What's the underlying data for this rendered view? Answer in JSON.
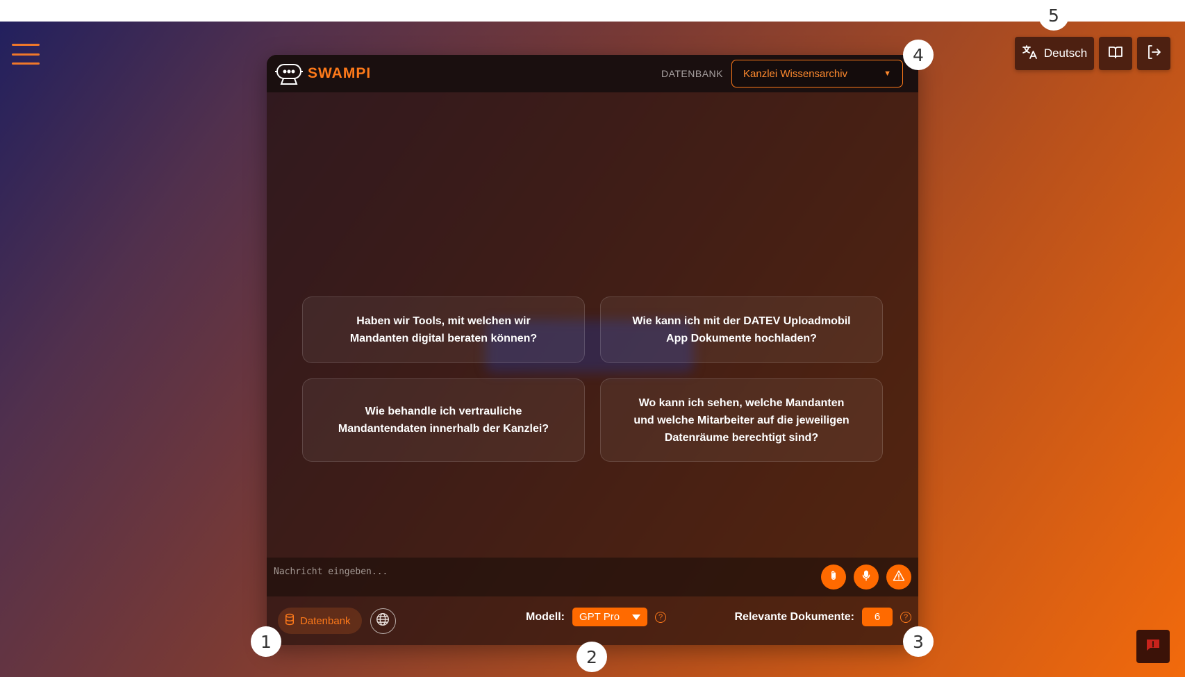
{
  "header": {
    "brand": "SWAMPI",
    "db_label": "DATENBANK",
    "db_selected": "Kanzlei Wissensarchiv"
  },
  "top_right": {
    "language": "Deutsch",
    "icons": [
      "translate-icon",
      "book-open-icon",
      "logout-icon"
    ]
  },
  "suggestions": [
    "Haben wir Tools, mit welchen wir Mandanten digital beraten können?",
    "Wie kann ich mit der DATEV Uploadmobil App Dokumente hochladen?",
    "Wie behandle ich vertrauliche Mandantendaten innerhalb der Kanzlei?",
    "Wo kann ich sehen, welche Mandanten und welche Mitarbeiter auf die jeweiligen Datenräume berechtigt sind?"
  ],
  "input": {
    "placeholder": "Nachricht eingeben...",
    "actions": [
      "paperclip-icon",
      "microphone-icon",
      "warning-icon"
    ]
  },
  "footer": {
    "db_button": "Datenbank",
    "model_label": "Modell:",
    "model_value": "GPT Pro",
    "docs_label": "Relevante Dokumente:",
    "docs_value": "6",
    "help": "?"
  },
  "callouts": [
    "1",
    "2",
    "3",
    "4",
    "5"
  ],
  "colors": {
    "accent": "#ff6a00",
    "header_bg": "#1a0f0f"
  }
}
